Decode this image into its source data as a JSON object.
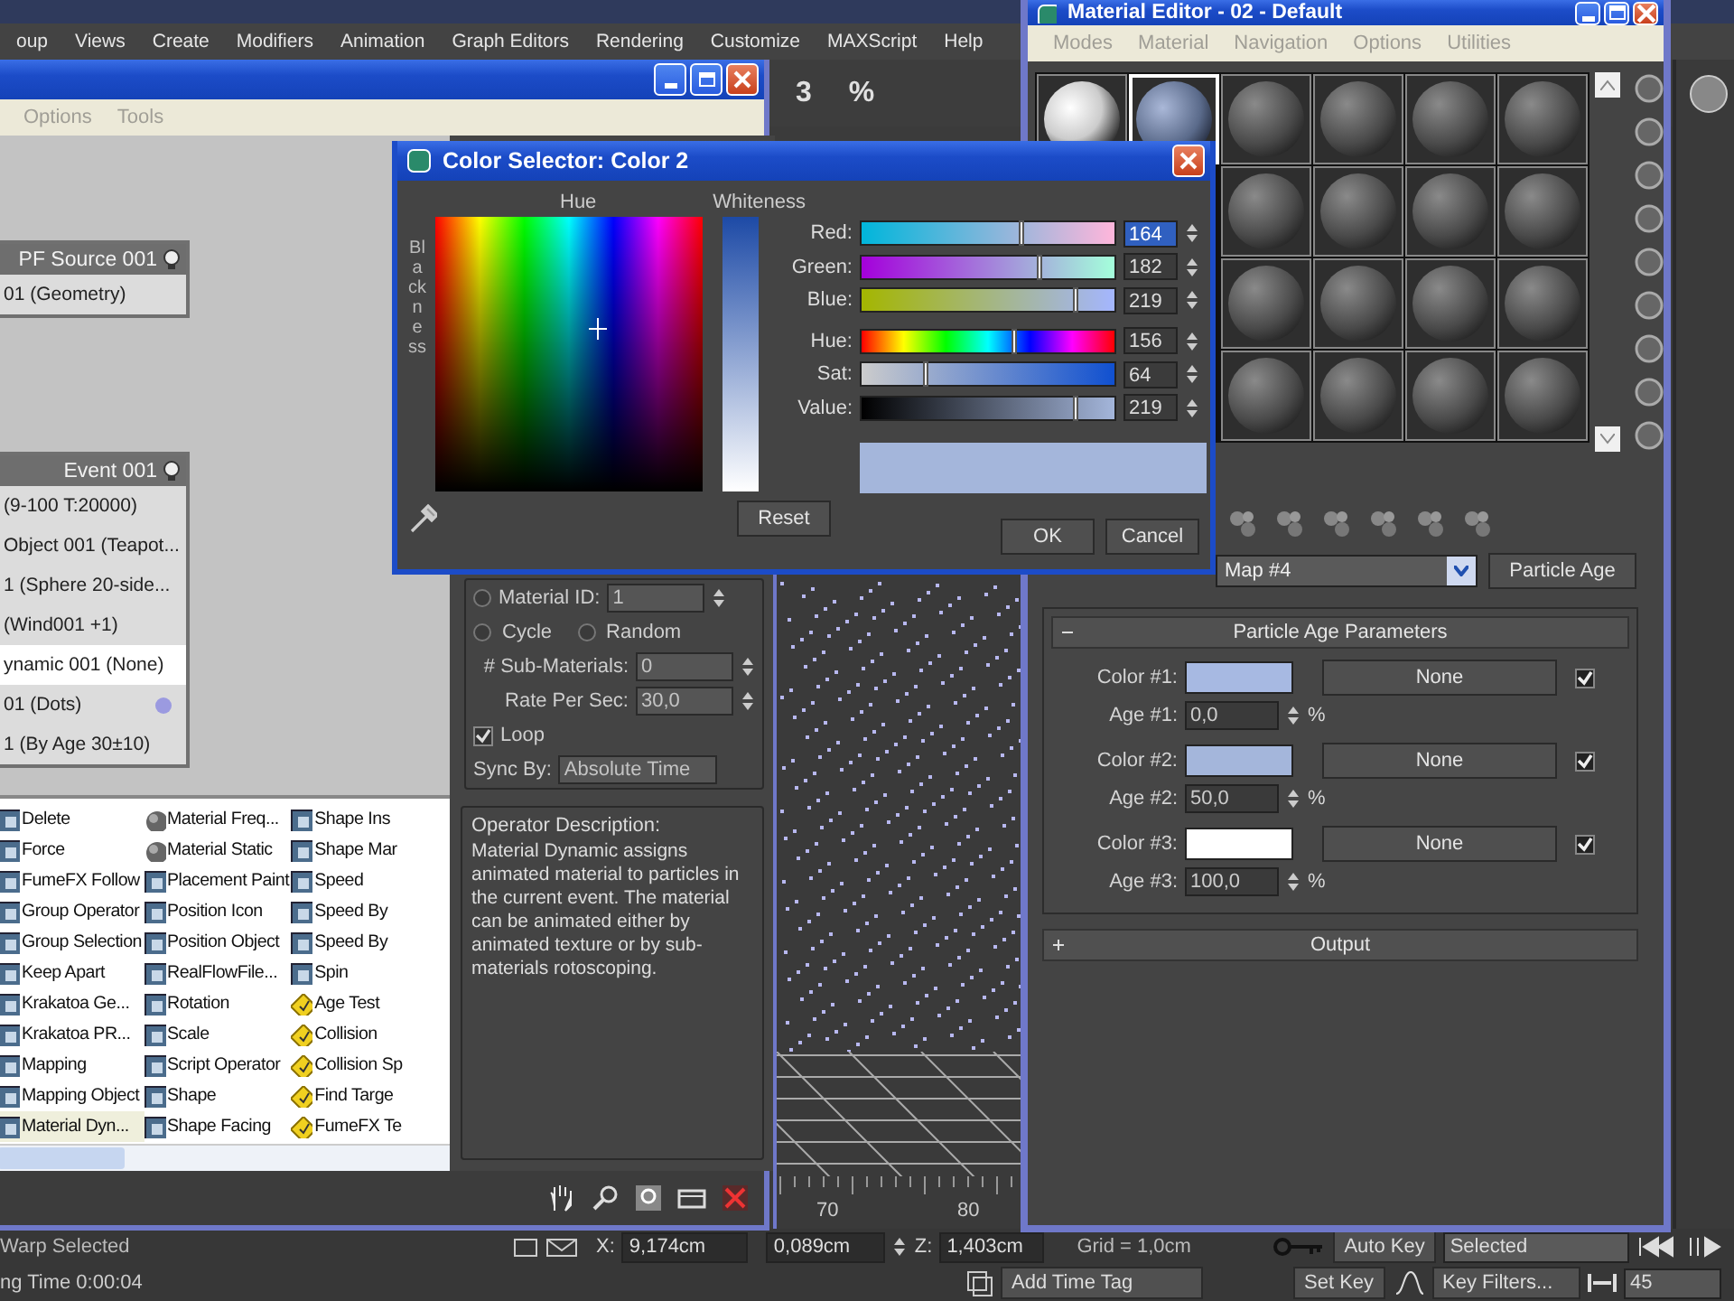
{
  "app_menu": [
    "oup",
    "Views",
    "Create",
    "Modifiers",
    "Animation",
    "Graph Editors",
    "Rendering",
    "Customize",
    "MAXScript",
    "Help"
  ],
  "snap_toggles": [
    "3",
    "%"
  ],
  "particle_view": {
    "menu": [
      "Options",
      "Tools"
    ],
    "nodes": [
      {
        "title": "PF Source 001",
        "rows": [
          {
            "label": "01 (Geometry)",
            "selected": false
          }
        ]
      },
      {
        "title": "Event 001",
        "rows": [
          {
            "label": "(9-100 T:20000)",
            "selected": false
          },
          {
            "label": "Object 001 (Teapot...",
            "selected": false
          },
          {
            "label": "1 (Sphere 20-side...",
            "selected": false
          },
          {
            "label": "(Wind001 +1)",
            "selected": false
          },
          {
            "label": "ynamic 001 (None)",
            "selected": true
          },
          {
            "label": "01 (Dots)",
            "selected": false,
            "color": "#9b9ae0"
          },
          {
            "label": "1 (By Age 30±10)",
            "selected": false
          }
        ]
      }
    ],
    "params": {
      "material_id": {
        "label": "Material ID:",
        "selected": false,
        "value": "1"
      },
      "modes": [
        {
          "label": "Cycle",
          "selected": false
        },
        {
          "label": "Random",
          "selected": false
        }
      ],
      "sub_materials": {
        "label": "# Sub-Materials:",
        "value": "0"
      },
      "rate": {
        "label": "Rate Per Sec:",
        "value": "30,0"
      },
      "loop": {
        "label": "Loop",
        "checked": true
      },
      "sync_by": {
        "label": "Sync By:",
        "value": "Absolute Time"
      }
    },
    "depot": {
      "columns": [
        [
          {
            "label": "Delete",
            "kind": "operator",
            "selected": false
          },
          {
            "label": "Force",
            "kind": "operator",
            "selected": false
          },
          {
            "label": "FumeFX Follow",
            "kind": "operator",
            "selected": false
          },
          {
            "label": "Group Operator",
            "kind": "operator",
            "selected": false
          },
          {
            "label": "Group Selection",
            "kind": "operator",
            "selected": false
          },
          {
            "label": "Keep Apart",
            "kind": "operator",
            "selected": false
          },
          {
            "label": "Krakatoa Ge...",
            "kind": "operator",
            "selected": false
          },
          {
            "label": "Krakatoa PR...",
            "kind": "operator",
            "selected": false
          },
          {
            "label": "Mapping",
            "kind": "operator",
            "selected": false
          },
          {
            "label": "Mapping Object",
            "kind": "operator",
            "selected": false
          },
          {
            "label": "Material Dyn...",
            "kind": "operator",
            "selected": true
          }
        ],
        [
          {
            "label": "Material Freq...",
            "kind": "material",
            "selected": false
          },
          {
            "label": "Material Static",
            "kind": "material",
            "selected": false
          },
          {
            "label": "Placement Paint",
            "kind": "operator",
            "selected": false
          },
          {
            "label": "Position Icon",
            "kind": "operator",
            "selected": false
          },
          {
            "label": "Position Object",
            "kind": "operator",
            "selected": false
          },
          {
            "label": "RealFlowFile...",
            "kind": "operator",
            "selected": false
          },
          {
            "label": "Rotation",
            "kind": "operator",
            "selected": false
          },
          {
            "label": "Scale",
            "kind": "operator",
            "selected": false
          },
          {
            "label": "Script Operator",
            "kind": "operator",
            "selected": false
          },
          {
            "label": "Shape",
            "kind": "operator",
            "selected": false
          },
          {
            "label": "Shape Facing",
            "kind": "operator",
            "selected": false
          }
        ],
        [
          {
            "label": "Shape Ins",
            "kind": "operator",
            "selected": false
          },
          {
            "label": "Shape Mar",
            "kind": "operator",
            "selected": false
          },
          {
            "label": "Speed",
            "kind": "operator",
            "selected": false
          },
          {
            "label": "Speed By",
            "kind": "operator",
            "selected": false
          },
          {
            "label": "Speed By",
            "kind": "operator",
            "selected": false
          },
          {
            "label": "Spin",
            "kind": "operator",
            "selected": false
          },
          {
            "label": "Age Test",
            "kind": "test",
            "selected": false
          },
          {
            "label": "Collision",
            "kind": "test",
            "selected": false
          },
          {
            "label": "Collision Sp",
            "kind": "test",
            "selected": false
          },
          {
            "label": "Find Targe",
            "kind": "test",
            "selected": false
          },
          {
            "label": "FumeFX Te",
            "kind": "test",
            "selected": false
          }
        ]
      ]
    },
    "description": {
      "title": "Operator Description:",
      "text": "Material Dynamic assigns animated material to particles in the current event. The material can be animated either by animated texture or by sub-materials rotoscoping."
    }
  },
  "viewport": {
    "ticks": [
      "70",
      "80"
    ]
  },
  "material_editor": {
    "title": "Material Editor - 02 - Default",
    "menu": [
      "Modes",
      "Material",
      "Navigation",
      "Options",
      "Utilities"
    ],
    "slot_rows": [
      [
        {
          "kind": "white",
          "selected": false
        },
        {
          "kind": "blue",
          "selected": true
        },
        {
          "kind": "grey",
          "selected": false
        },
        {
          "kind": "grey",
          "selected": false
        },
        {
          "kind": "grey",
          "selected": false
        },
        {
          "kind": "grey",
          "selected": false
        }
      ],
      [
        {
          "kind": "grey",
          "selected": false
        },
        {
          "kind": "grey",
          "selected": false
        },
        {
          "kind": "grey",
          "selected": false
        },
        {
          "kind": "grey",
          "selected": false
        }
      ],
      [
        {
          "kind": "grey",
          "selected": false
        },
        {
          "kind": "grey",
          "selected": false
        },
        {
          "kind": "grey",
          "selected": false
        },
        {
          "kind": "grey",
          "selected": false
        }
      ],
      [
        {
          "kind": "grey",
          "selected": false
        },
        {
          "kind": "grey",
          "selected": false
        },
        {
          "kind": "grey",
          "selected": false
        },
        {
          "kind": "grey",
          "selected": false
        }
      ]
    ],
    "map": "Map #4",
    "type_button": "Particle Age",
    "rollout": {
      "title": "Particle Age Parameters",
      "expanded": true,
      "rows": [
        {
          "color_label": "Color #1:",
          "color": "#a7b9e2",
          "map": "None",
          "checked": true,
          "age_label": "Age #1:",
          "age": "0,0",
          "unit": "%"
        },
        {
          "color_label": "Color #2:",
          "color": "#a4b6db",
          "map": "None",
          "checked": true,
          "age_label": "Age #2:",
          "age": "50,0",
          "unit": "%"
        },
        {
          "color_label": "Color #3:",
          "color": "#ffffff",
          "map": "None",
          "checked": true,
          "age_label": "Age #3:",
          "age": "100,0",
          "unit": "%"
        }
      ]
    },
    "output": {
      "title": "Output",
      "expanded": false
    }
  },
  "color_selector": {
    "title": "Color Selector: Color 2",
    "hue_label": "Hue",
    "whiteness_label": "Whiteness",
    "blackness_label": "Blackness",
    "channels": [
      {
        "kind": "red",
        "label": "Red:",
        "value": "164",
        "level": 0.64,
        "selected": true
      },
      {
        "kind": "green",
        "label": "Green:",
        "value": "182",
        "level": 0.71,
        "selected": false
      },
      {
        "kind": "blue",
        "label": "Blue:",
        "value": "219",
        "level": 0.86,
        "selected": false
      },
      {
        "kind": "hue",
        "label": "Hue:",
        "value": "156",
        "level": 0.61,
        "selected": false
      },
      {
        "kind": "sat",
        "label": "Sat:",
        "value": "64",
        "level": 0.25,
        "selected": false
      },
      {
        "kind": "value",
        "label": "Value:",
        "value": "219",
        "level": 0.86,
        "selected": false
      }
    ],
    "reset": "Reset",
    "ok": "OK",
    "cancel": "Cancel"
  },
  "status": {
    "prompt": "Warp Selected",
    "x_label": "X:",
    "x": "9,174cm",
    "y": "0,089cm",
    "z_label": "Z:",
    "z": "1,403cm",
    "grid": "Grid = 1,0cm",
    "auto_key": "Auto Key",
    "key_mode": "Selected",
    "time": "ng Time 0:00:04",
    "add_time_tag": "Add Time Tag",
    "set_key": "Set Key",
    "key_filters": "Key Filters...",
    "frame": "45"
  }
}
